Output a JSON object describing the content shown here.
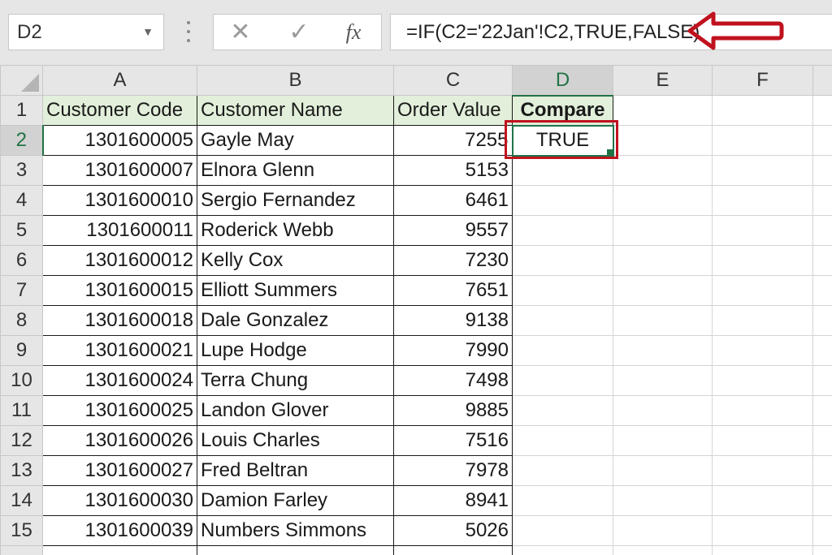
{
  "formula_bar": {
    "name_box": "D2",
    "cancel_icon": "x-icon",
    "enter_icon": "checkmark-icon",
    "function_label": "fx",
    "formula": "=IF(C2='22Jan'!C2,TRUE,FALSE)"
  },
  "annotation": {
    "arrow_color": "#c0121e",
    "box_color": "#c0121e"
  },
  "columns": [
    "A",
    "B",
    "C",
    "D",
    "E",
    "F"
  ],
  "header_row": {
    "row": "1",
    "customer_code": "Customer Code",
    "customer_name": "Customer Name",
    "order_value": "Order Value",
    "compare": "Compare"
  },
  "rows": [
    {
      "row": "2",
      "code": "1301600005",
      "name": "Gayle May",
      "value": "7255",
      "compare": "TRUE"
    },
    {
      "row": "3",
      "code": "1301600007",
      "name": "Elnora Glenn",
      "value": "5153",
      "compare": ""
    },
    {
      "row": "4",
      "code": "1301600010",
      "name": "Sergio Fernandez",
      "value": "6461",
      "compare": ""
    },
    {
      "row": "5",
      "code": "1301600011",
      "name": "Roderick Webb",
      "value": "9557",
      "compare": ""
    },
    {
      "row": "6",
      "code": "1301600012",
      "name": "Kelly Cox",
      "value": "7230",
      "compare": ""
    },
    {
      "row": "7",
      "code": "1301600015",
      "name": "Elliott Summers",
      "value": "7651",
      "compare": ""
    },
    {
      "row": "8",
      "code": "1301600018",
      "name": "Dale Gonzalez",
      "value": "9138",
      "compare": ""
    },
    {
      "row": "9",
      "code": "1301600021",
      "name": "Lupe Hodge",
      "value": "7990",
      "compare": ""
    },
    {
      "row": "10",
      "code": "1301600024",
      "name": "Terra Chung",
      "value": "7498",
      "compare": ""
    },
    {
      "row": "11",
      "code": "1301600025",
      "name": "Landon Glover",
      "value": "9885",
      "compare": ""
    },
    {
      "row": "12",
      "code": "1301600026",
      "name": "Louis Charles",
      "value": "7516",
      "compare": ""
    },
    {
      "row": "13",
      "code": "1301600027",
      "name": "Fred Beltran",
      "value": "7978",
      "compare": ""
    },
    {
      "row": "14",
      "code": "1301600030",
      "name": "Damion Farley",
      "value": "8941",
      "compare": ""
    },
    {
      "row": "15",
      "code": "1301600039",
      "name": "Numbers Simmons",
      "value": "5026",
      "compare": ""
    }
  ],
  "selected_cell": "D2",
  "accent_color": "#217346"
}
